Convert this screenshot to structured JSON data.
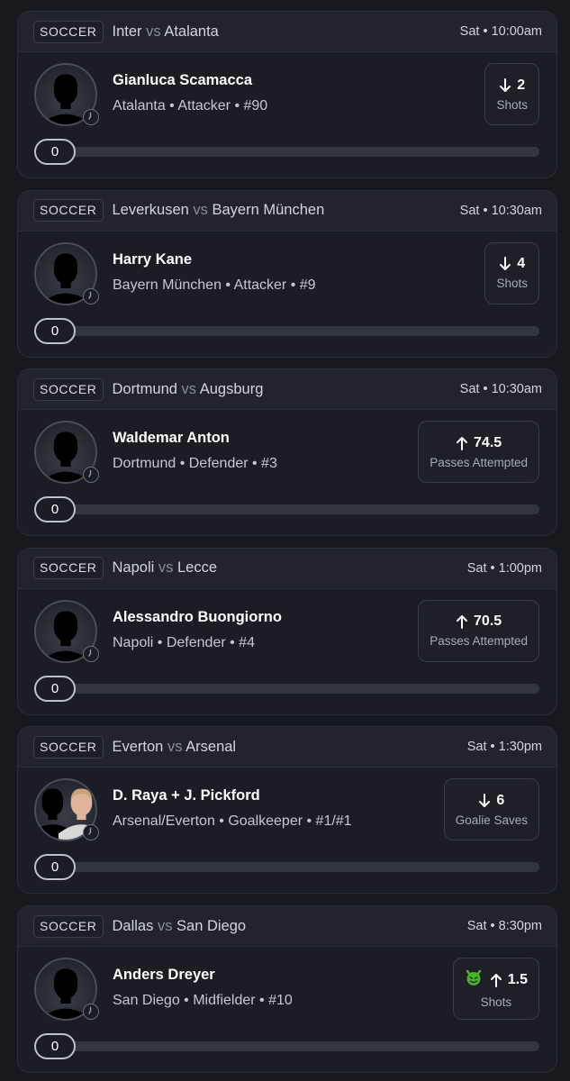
{
  "cards": [
    {
      "sport": "SOCCER",
      "home": "Inter",
      "vs": "vs",
      "away": "Atalanta",
      "time": "Sat • 10:00am",
      "player": "Gianluca Scamacca",
      "meta": "Atalanta • Attacker • #90",
      "direction": "down",
      "line": "2",
      "stat": "Shots",
      "progress_label": "0",
      "progress": 0,
      "avatar_icon": "player-photo",
      "has_emoji": false,
      "colors": {
        "skin": "#c28a6c",
        "hair": "#2a1e1a",
        "shirt": "#8a1f2e"
      }
    },
    {
      "sport": "SOCCER",
      "home": "Leverkusen",
      "vs": "vs",
      "away": "Bayern München",
      "time": "Sat • 10:30am",
      "player": "Harry Kane",
      "meta": "Bayern München • Attacker • #9",
      "direction": "down",
      "line": "4",
      "stat": "Shots",
      "progress_label": "0",
      "progress": 0,
      "avatar_icon": "player-photo",
      "has_emoji": false,
      "colors": {
        "skin": "#d9a88a",
        "hair": "#8a6a4a",
        "shirt": "#e8e8ea"
      }
    },
    {
      "sport": "SOCCER",
      "home": "Dortmund",
      "vs": "vs",
      "away": "Augsburg",
      "time": "Sat • 10:30am",
      "player": "Waldemar Anton",
      "meta": "Dortmund • Defender • #3",
      "direction": "up",
      "line": "74.5",
      "stat": "Passes Attempted",
      "progress_label": "0",
      "progress": 0,
      "avatar_icon": "player-photo",
      "has_emoji": false,
      "colors": {
        "skin": "#dcae94",
        "hair": "#b89a6a",
        "shirt": "#1a1a1a"
      }
    },
    {
      "sport": "SOCCER",
      "home": "Napoli",
      "vs": "vs",
      "away": "Lecce",
      "time": "Sat • 1:00pm",
      "player": "Alessandro Buongiorno",
      "meta": "Napoli • Defender • #4",
      "direction": "up",
      "line": "70.5",
      "stat": "Passes Attempted",
      "progress_label": "0",
      "progress": 0,
      "avatar_icon": "player-photo",
      "has_emoji": false,
      "colors": {
        "skin": "#c89478",
        "hair": "#2a2220",
        "shirt": "#5aa8d8"
      }
    },
    {
      "sport": "SOCCER",
      "home": "Everton",
      "vs": "vs",
      "away": "Arsenal",
      "time": "Sat • 1:30pm",
      "player": "D. Raya + J. Pickford",
      "meta": "Arsenal/Everton • Goalkeeper • #1/#1",
      "direction": "down",
      "line": "6",
      "stat": "Goalie Saves",
      "progress_label": "0",
      "progress": 0,
      "avatar_icon": "player-photo-pair",
      "has_emoji": false,
      "colors": {
        "skin": "#b88466",
        "hair": "#1e1816",
        "shirt": "#2a2a2a"
      }
    },
    {
      "sport": "SOCCER",
      "home": "Dallas",
      "vs": "vs",
      "away": "San Diego",
      "time": "Sat • 8:30pm",
      "player": "Anders Dreyer",
      "meta": "San Diego • Midfielder • #10",
      "direction": "up",
      "line": "1.5",
      "stat": "Shots",
      "progress_label": "0",
      "progress": 0,
      "avatar_icon": "player-photo",
      "has_emoji": true,
      "emoji_icon": "devil-icon",
      "colors": {
        "skin": "#d4a084",
        "hair": "#5a4634",
        "shirt": "#1e1e22"
      }
    }
  ],
  "theme": {
    "accent_up": "#ffffff",
    "emoji_green": "#4caf2e"
  }
}
